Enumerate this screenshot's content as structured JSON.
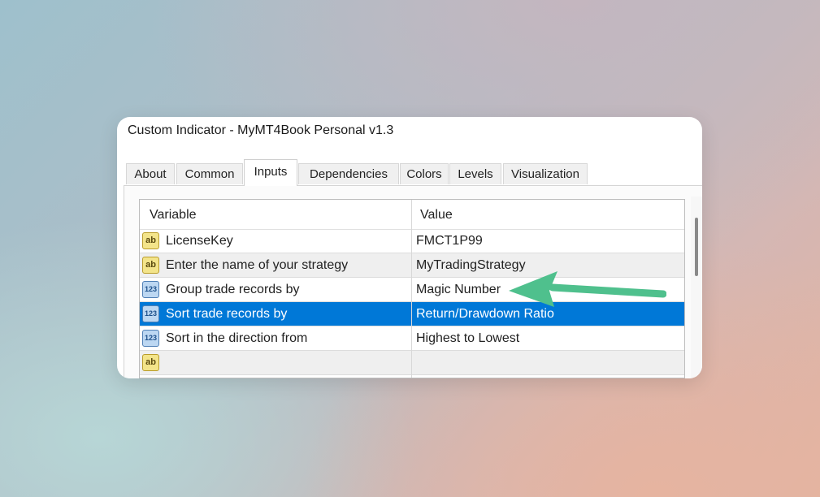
{
  "window": {
    "title": "Custom Indicator - MyMT4Book Personal v1.3"
  },
  "tabs": [
    {
      "label": "About"
    },
    {
      "label": "Common"
    },
    {
      "label": "Inputs"
    },
    {
      "label": "Dependencies"
    },
    {
      "label": "Colors"
    },
    {
      "label": "Levels"
    },
    {
      "label": "Visualization"
    }
  ],
  "active_tab": "Inputs",
  "table": {
    "columns": [
      "Variable",
      "Value"
    ],
    "rows": [
      {
        "icon": "ab",
        "variable": "LicenseKey",
        "value": "FMCT1P99"
      },
      {
        "icon": "ab",
        "variable": "Enter the name of your strategy",
        "value": "MyTradingStrategy"
      },
      {
        "icon": "123",
        "variable": "Group trade records by",
        "value": "Magic Number"
      },
      {
        "icon": "123",
        "variable": "Sort trade records by",
        "value": "Return/Drawdown Ratio"
      },
      {
        "icon": "123",
        "variable": "Sort in the direction from",
        "value": "Highest to Lowest"
      },
      {
        "icon": "ab",
        "variable": "",
        "value": ""
      }
    ],
    "selected_row": 3
  },
  "colors": {
    "selection": "#0078d7",
    "annotation_arrow": "#4fc08d"
  }
}
